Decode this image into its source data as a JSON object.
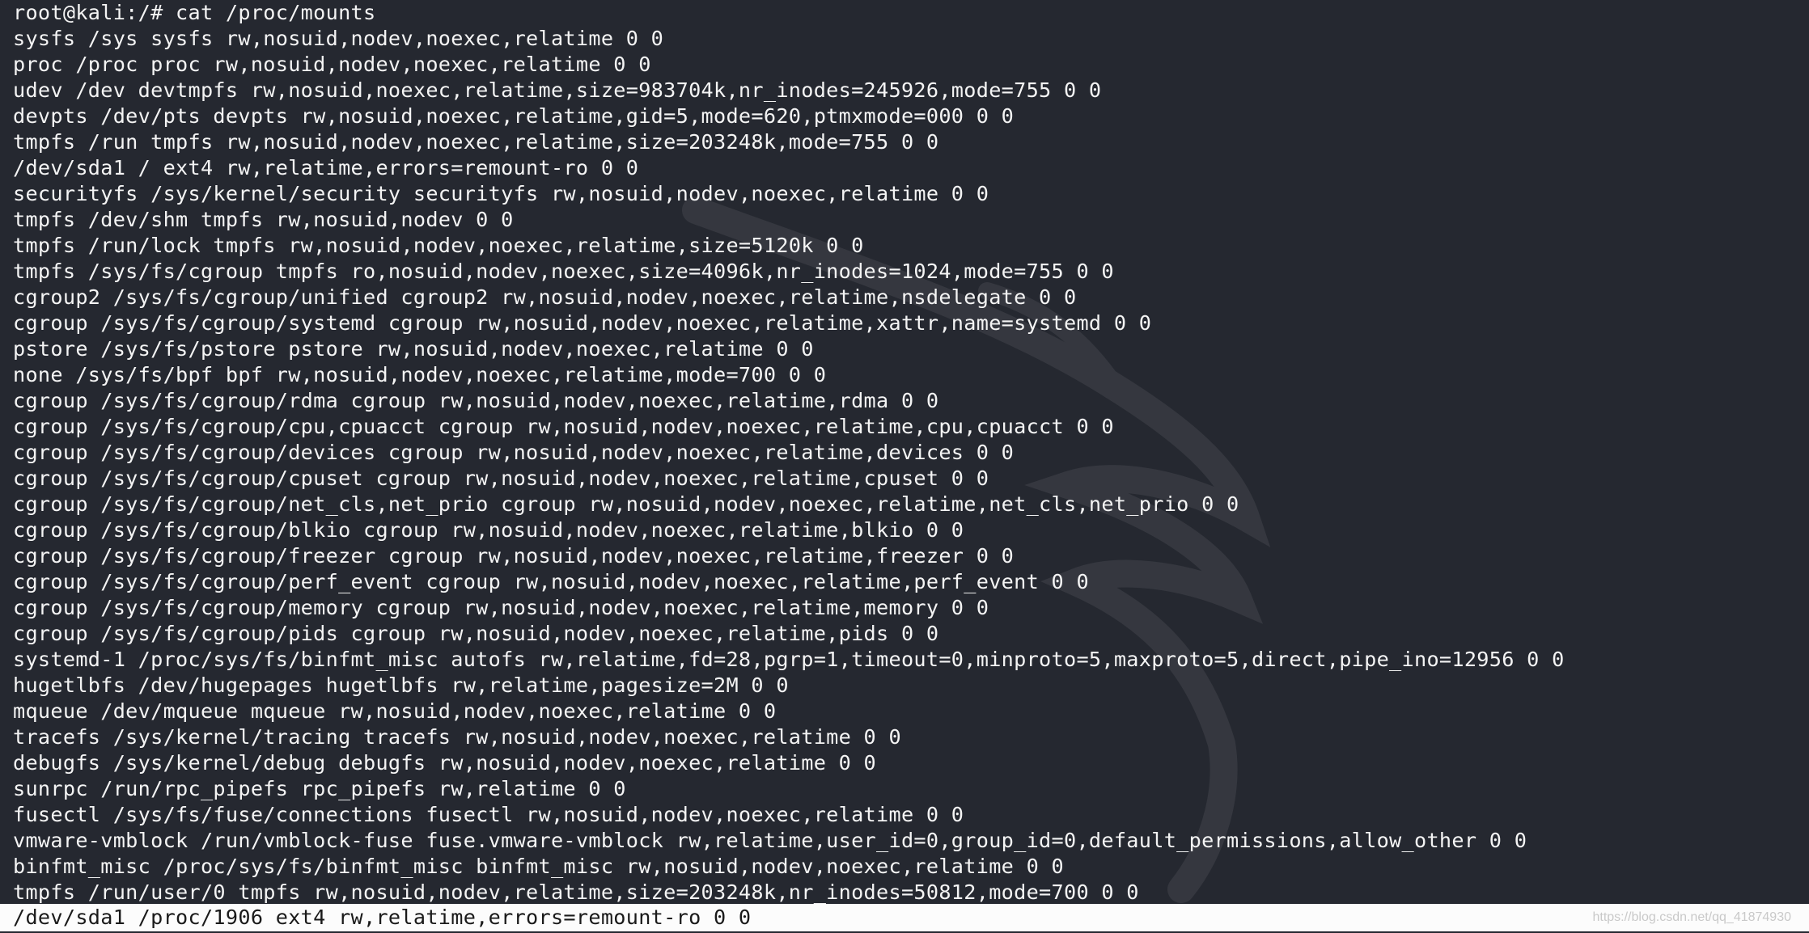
{
  "terminal": {
    "prompt_line": "root@kali:/# cat /proc/mounts",
    "output_lines": [
      "sysfs /sys sysfs rw,nosuid,nodev,noexec,relatime 0 0",
      "proc /proc proc rw,nosuid,nodev,noexec,relatime 0 0",
      "udev /dev devtmpfs rw,nosuid,noexec,relatime,size=983704k,nr_inodes=245926,mode=755 0 0",
      "devpts /dev/pts devpts rw,nosuid,noexec,relatime,gid=5,mode=620,ptmxmode=000 0 0",
      "tmpfs /run tmpfs rw,nosuid,nodev,noexec,relatime,size=203248k,mode=755 0 0",
      "/dev/sda1 / ext4 rw,relatime,errors=remount-ro 0 0",
      "securityfs /sys/kernel/security securityfs rw,nosuid,nodev,noexec,relatime 0 0",
      "tmpfs /dev/shm tmpfs rw,nosuid,nodev 0 0",
      "tmpfs /run/lock tmpfs rw,nosuid,nodev,noexec,relatime,size=5120k 0 0",
      "tmpfs /sys/fs/cgroup tmpfs ro,nosuid,nodev,noexec,size=4096k,nr_inodes=1024,mode=755 0 0",
      "cgroup2 /sys/fs/cgroup/unified cgroup2 rw,nosuid,nodev,noexec,relatime,nsdelegate 0 0",
      "cgroup /sys/fs/cgroup/systemd cgroup rw,nosuid,nodev,noexec,relatime,xattr,name=systemd 0 0",
      "pstore /sys/fs/pstore pstore rw,nosuid,nodev,noexec,relatime 0 0",
      "none /sys/fs/bpf bpf rw,nosuid,nodev,noexec,relatime,mode=700 0 0",
      "cgroup /sys/fs/cgroup/rdma cgroup rw,nosuid,nodev,noexec,relatime,rdma 0 0",
      "cgroup /sys/fs/cgroup/cpu,cpuacct cgroup rw,nosuid,nodev,noexec,relatime,cpu,cpuacct 0 0",
      "cgroup /sys/fs/cgroup/devices cgroup rw,nosuid,nodev,noexec,relatime,devices 0 0",
      "cgroup /sys/fs/cgroup/cpuset cgroup rw,nosuid,nodev,noexec,relatime,cpuset 0 0",
      "cgroup /sys/fs/cgroup/net_cls,net_prio cgroup rw,nosuid,nodev,noexec,relatime,net_cls,net_prio 0 0",
      "cgroup /sys/fs/cgroup/blkio cgroup rw,nosuid,nodev,noexec,relatime,blkio 0 0",
      "cgroup /sys/fs/cgroup/freezer cgroup rw,nosuid,nodev,noexec,relatime,freezer 0 0",
      "cgroup /sys/fs/cgroup/perf_event cgroup rw,nosuid,nodev,noexec,relatime,perf_event 0 0",
      "cgroup /sys/fs/cgroup/memory cgroup rw,nosuid,nodev,noexec,relatime,memory 0 0",
      "cgroup /sys/fs/cgroup/pids cgroup rw,nosuid,nodev,noexec,relatime,pids 0 0",
      "systemd-1 /proc/sys/fs/binfmt_misc autofs rw,relatime,fd=28,pgrp=1,timeout=0,minproto=5,maxproto=5,direct,pipe_ino=12956 0 0",
      "hugetlbfs /dev/hugepages hugetlbfs rw,relatime,pagesize=2M 0 0",
      "mqueue /dev/mqueue mqueue rw,nosuid,nodev,noexec,relatime 0 0",
      "tracefs /sys/kernel/tracing tracefs rw,nosuid,nodev,noexec,relatime 0 0",
      "debugfs /sys/kernel/debug debugfs rw,nosuid,nodev,noexec,relatime 0 0",
      "sunrpc /run/rpc_pipefs rpc_pipefs rw,relatime 0 0",
      "fusectl /sys/fs/fuse/connections fusectl rw,nosuid,nodev,noexec,relatime 0 0",
      "vmware-vmblock /run/vmblock-fuse fuse.vmware-vmblock rw,relatime,user_id=0,group_id=0,default_permissions,allow_other 0 0",
      "binfmt_misc /proc/sys/fs/binfmt_misc binfmt_misc rw,nosuid,nodev,noexec,relatime 0 0",
      "tmpfs /run/user/0 tmpfs rw,nosuid,nodev,relatime,size=203248k,nr_inodes=50812,mode=700 0 0"
    ],
    "highlighted_line": "/dev/sda1 /proc/1906 ext4 rw,relatime,errors=remount-ro 0 0",
    "watermark_text": "https://blog.csdn.net/qq_41874930"
  },
  "colors": {
    "background": "#252830",
    "foreground": "#f4f4f4",
    "selection_background": "#fcfcfc",
    "selection_foreground": "#1a1a1a"
  },
  "icons": {
    "background_logo": "kali-dragon-logo"
  }
}
